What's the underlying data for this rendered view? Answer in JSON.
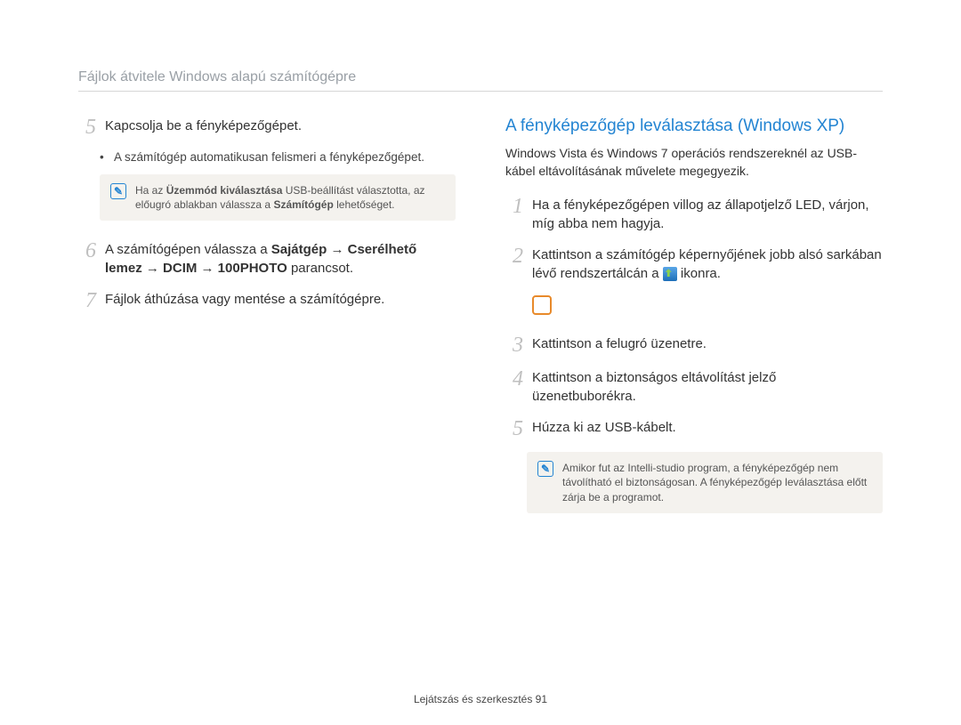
{
  "header": {
    "title": "Fájlok átvitele Windows alapú számítógépre"
  },
  "left": {
    "step5": {
      "num": "5",
      "text": "Kapcsolja be a fényképezőgépet."
    },
    "bullet": "A számítógép automatikusan felismeri a fényképezőgépet.",
    "note": {
      "pre": "Ha az ",
      "b1": "Üzemmód kiválasztása",
      "mid": " USB-beállítást választotta, az előugró ablakban válassza a ",
      "b2": "Számítógép",
      "post": " lehetőséget."
    },
    "step6": {
      "num": "6",
      "pre": "A számítógépen válassza a ",
      "bold": "Sajátgép → Cserélhető lemez → DCIM → 100PHOTO",
      "post": " parancsot."
    },
    "step7": {
      "num": "7",
      "text": "Fájlok áthúzása vagy mentése a számítógépre."
    }
  },
  "right": {
    "title": "A fényképezőgép leválasztása (Windows XP)",
    "intro": "Windows Vista és Windows 7 operációs rendszereknél az USB-kábel eltávolításának művelete megegyezik.",
    "step1": {
      "num": "1",
      "text": "Ha a fényképezőgépen villog az állapotjelző LED, várjon, míg abba nem hagyja."
    },
    "step2": {
      "num": "2",
      "pre": "Kattintson a számítógép képernyőjének jobb alsó sarkában lévő rendszertálcán a ",
      "post": " ikonra."
    },
    "step3": {
      "num": "3",
      "text": "Kattintson a felugró üzenetre."
    },
    "step4": {
      "num": "4",
      "text": "Kattintson a biztonságos eltávolítást jelző üzenetbuborékra."
    },
    "step5": {
      "num": "5",
      "text": "Húzza ki az USB-kábelt."
    },
    "note": "Amikor fut az Intelli-studio program, a fényképezőgép nem távolítható el biztonságosan. A fényképezőgép leválasztása előtt zárja be a programot."
  },
  "footer": {
    "text": "Lejátszás és szerkesztés  91"
  }
}
